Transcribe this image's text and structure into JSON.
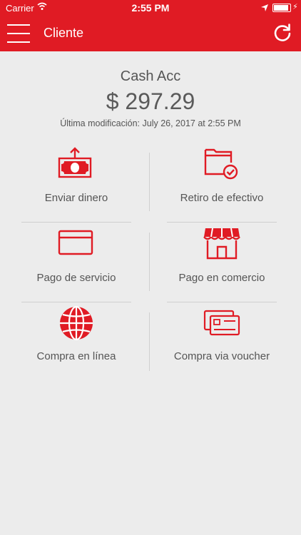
{
  "status_bar": {
    "carrier": "Carrier",
    "time": "2:55 PM"
  },
  "header": {
    "title": "Cliente",
    "menu_icon": "hamburger-menu-icon",
    "refresh_icon": "refresh-icon"
  },
  "account": {
    "name": "Cash Acc",
    "balance": "$ 297.29",
    "modified": "Última modificación: July 26, 2017 at 2:55 PM"
  },
  "actions": [
    {
      "label": "Enviar dinero",
      "icon": "send-money-icon"
    },
    {
      "label": "Retiro de efectivo",
      "icon": "withdraw-cash-icon"
    },
    {
      "label": "Pago de servicio",
      "icon": "service-payment-card-icon"
    },
    {
      "label": "Pago en comercio",
      "icon": "store-icon"
    },
    {
      "label": "Compra en línea",
      "icon": "globe-icon"
    },
    {
      "label": "Compra via voucher",
      "icon": "voucher-cards-icon"
    }
  ],
  "colors": {
    "brand_red": "#e01b24",
    "background": "#ececec",
    "text_gray": "#555555"
  }
}
